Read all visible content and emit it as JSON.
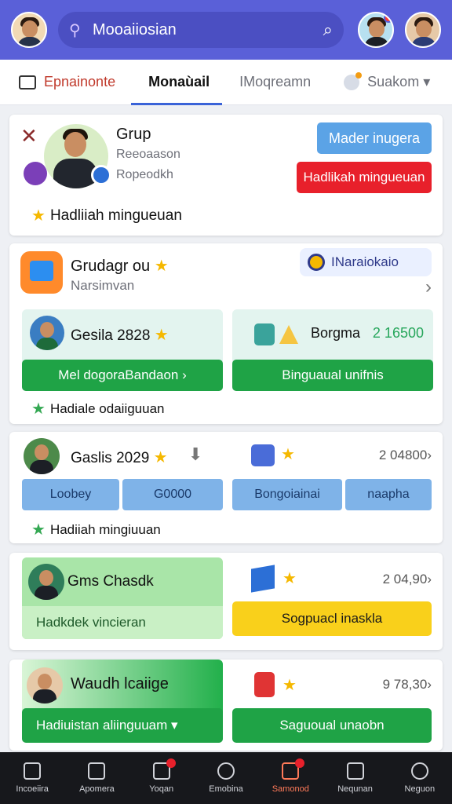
{
  "header": {
    "search_text": "Mooaiiosian",
    "search_icon": "search-icon"
  },
  "tabs": [
    {
      "label": "Epnainonte"
    },
    {
      "label": "Monaùail"
    },
    {
      "label": "IMoqreamn"
    },
    {
      "label": "Suakom ▾"
    }
  ],
  "card1": {
    "title": "Grup",
    "sub1": "Reeoaason",
    "sub2": "Ropeodkh",
    "btn_primary": "Mader inugera",
    "btn_danger": "Hadlikah mingueuan",
    "reward": "Hadliiah mingueuan"
  },
  "card2": {
    "title": "Grudagr ou",
    "sub": "Narsimvan",
    "pill": "INaraiokaio",
    "left_name": "Gesila 2828",
    "left_btn": "Mel dogoraBandaon ›",
    "right_name": "Borgma",
    "right_val": "2 16500",
    "right_btn": "Binguaual unifnis",
    "reward": "Hadiale odaiiguuan"
  },
  "card3": {
    "name": "Gaslis 2029",
    "right_val": "2 04800›",
    "btn1": "Loobey",
    "btn2": "G0000",
    "btn3": "Bongoiainai",
    "btn4": "naapha",
    "reward": "Hadiiah mingiuuan"
  },
  "card4": {
    "name": "Gms Chasdk",
    "bar": "Hadkdek vincieran",
    "right_val": "2 04,90›",
    "btn": "Sogpuacl inaskla"
  },
  "card5": {
    "name": "Waudh lcaiige",
    "bar": "Hadiuistan aliinguuam ▾",
    "right_val": "9 78,30›",
    "btn": "Saguoual unaobn"
  },
  "bottom_nav": [
    {
      "label": "Incoeiira"
    },
    {
      "label": "Apomera"
    },
    {
      "label": "Yoqan"
    },
    {
      "label": "Emobina"
    },
    {
      "label": "Samonod"
    },
    {
      "label": "Nequnan"
    },
    {
      "label": "Neguon"
    }
  ],
  "colors": {
    "header_bg": "#5a60d8",
    "accent_blue": "#3a63d8",
    "green": "#1fa346",
    "red": "#e8202b",
    "yellow": "#f9d01b"
  }
}
